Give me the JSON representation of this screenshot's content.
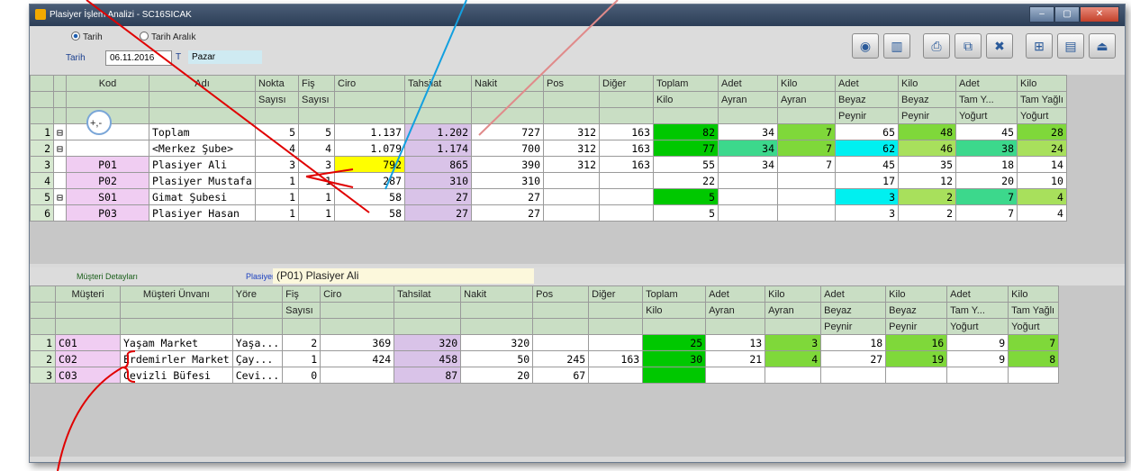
{
  "window": {
    "title": "Plasiyer İşlem Analizi - SC16SICAK",
    "btn_min": "–",
    "btn_max": "▢",
    "btn_close": "✕"
  },
  "filters": {
    "radio1": "Tarih",
    "radio2": "Tarih Aralık",
    "date_label": "Tarih",
    "date_value": "06.11.2016",
    "dow_btn": "T",
    "dow_value": "Pazar"
  },
  "toolbar": [
    {
      "name": "refresh-icon",
      "glyph": "◉"
    },
    {
      "name": "chart-icon",
      "glyph": "▥"
    },
    {
      "name": "print-icon",
      "glyph": "⎙"
    },
    {
      "name": "preview-icon",
      "glyph": "⧉"
    },
    {
      "name": "excel-icon",
      "glyph": "✖"
    },
    {
      "name": "tree-icon",
      "glyph": "⊞"
    },
    {
      "name": "columns-icon",
      "glyph": "▤"
    },
    {
      "name": "exit-icon",
      "glyph": "⏏"
    }
  ],
  "top_grid": {
    "header1": [
      "Kod",
      "Adı",
      "Nokta",
      "Fiş",
      "Ciro",
      "Tahsilat",
      "Nakit",
      "Pos",
      "Diğer",
      "Toplam",
      "Adet",
      "Kilo",
      "Adet",
      "Kilo",
      "Adet",
      "Kilo"
    ],
    "header2": [
      "",
      "",
      "Sayısı",
      "Sayısı",
      "",
      "",
      "",
      "",
      "",
      "Kilo",
      "Ayran",
      "Ayran",
      "Beyaz",
      "Beyaz",
      "Tam Y...",
      "Tam Yağlı"
    ],
    "header3": [
      "+,-",
      "",
      "",
      "",
      "",
      "",
      "",
      "",
      "",
      "",
      "",
      "",
      "Peynir",
      "Peynir",
      "Yoğurt",
      "Yoğurt"
    ],
    "rows": [
      {
        "n": "1",
        "exp": "⊟",
        "kod": "",
        "adi": "Toplam",
        "cells": [
          "5",
          "5",
          "1.137",
          "1.202",
          "727",
          "312",
          "163",
          "82",
          "34",
          "7",
          "65",
          "48",
          "45",
          "28"
        ]
      },
      {
        "n": "2",
        "exp": "⊟",
        "kod": "",
        "adi": "<Merkez Şube>",
        "cells": [
          "4",
          "4",
          "1.079",
          "1.174",
          "700",
          "312",
          "163",
          "77",
          "34",
          "7",
          "62",
          "46",
          "38",
          "24"
        ]
      },
      {
        "n": "3",
        "exp": "",
        "kod": "P01",
        "adi": "Plasiyer Ali",
        "cells": [
          "3",
          "3",
          "792",
          "865",
          "390",
          "312",
          "163",
          "55",
          "34",
          "7",
          "45",
          "35",
          "18",
          "14"
        ]
      },
      {
        "n": "4",
        "exp": "",
        "kod": "P02",
        "adi": "Plasiyer Mustafa",
        "cells": [
          "1",
          "1",
          "287",
          "310",
          "310",
          "",
          "",
          "22",
          "",
          "",
          "17",
          "12",
          "20",
          "10"
        ]
      },
      {
        "n": "5",
        "exp": "⊟",
        "kod": "S01",
        "adi": "Gimat Şubesi",
        "cells": [
          "1",
          "1",
          "58",
          "27",
          "27",
          "",
          "",
          "5",
          "",
          "",
          "3",
          "2",
          "7",
          "4"
        ]
      },
      {
        "n": "6",
        "exp": "",
        "kod": "P03",
        "adi": "Plasiyer Hasan",
        "cells": [
          "1",
          "1",
          "58",
          "27",
          "27",
          "",
          "",
          "5",
          "",
          "",
          "3",
          "2",
          "7",
          "4"
        ]
      }
    ]
  },
  "detail": {
    "label_left": "Müşteri Detayları",
    "label_plasiyer": "Plasiyer",
    "plasiyer_value": "(P01) Plasiyer Ali"
  },
  "bottom_grid": {
    "header1": [
      "Müşteri",
      "Müşteri Ünvanı",
      "Yöre",
      "Fiş",
      "Ciro",
      "Tahsilat",
      "Nakit",
      "Pos",
      "Diğer",
      "Toplam",
      "Adet",
      "Kilo",
      "Adet",
      "Kilo",
      "Adet",
      "Kilo"
    ],
    "header2": [
      "",
      "",
      "",
      "Sayısı",
      "",
      "",
      "",
      "",
      "",
      "Kilo",
      "Ayran",
      "Ayran",
      "Beyaz",
      "Beyaz",
      "Tam Y...",
      "Tam Yağlı"
    ],
    "header3": [
      "",
      "",
      "",
      "",
      "",
      "",
      "",
      "",
      "",
      "",
      "",
      "",
      "Peynir",
      "Peynir",
      "Yoğurt",
      "Yoğurt"
    ],
    "rows": [
      {
        "n": "1",
        "kod": "C01",
        "unvan": "Yaşam Market",
        "yore": "Yaşa...",
        "cells": [
          "2",
          "369",
          "320",
          "320",
          "",
          "",
          "25",
          "13",
          "3",
          "18",
          "16",
          "9",
          "7"
        ]
      },
      {
        "n": "2",
        "kod": "C02",
        "unvan": "Erdemirler Market",
        "yore": "Çay...",
        "cells": [
          "1",
          "424",
          "458",
          "50",
          "245",
          "163",
          "30",
          "21",
          "4",
          "27",
          "19",
          "9",
          "8"
        ]
      },
      {
        "n": "3",
        "kod": "C03",
        "unvan": "Cevizli Büfesi",
        "yore": "Cevi...",
        "cells": [
          "0",
          "",
          "87",
          "20",
          "67",
          "",
          "",
          "",
          "",
          "",
          "",
          "",
          ""
        ]
      }
    ]
  },
  "colors": {
    "green_dark": "#00c800",
    "green_light": "#7fd83a",
    "cyan": "#00f0f0",
    "yellow": "#ffff00",
    "pink": "#f0cdf2",
    "purple": "#d9c3e8"
  }
}
